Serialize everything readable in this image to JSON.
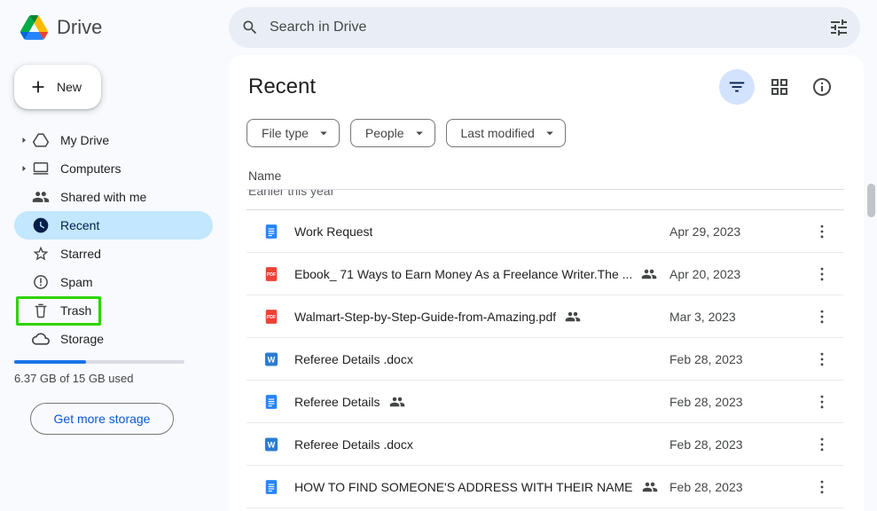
{
  "app": {
    "title": "Drive"
  },
  "topbar": {
    "search_placeholder": "Search in Drive"
  },
  "sidebar": {
    "new_button_label": "New",
    "items": [
      {
        "id": "my-drive",
        "label": "My Drive",
        "icon": "my-drive-icon",
        "expandable": true,
        "selected": false
      },
      {
        "id": "computers",
        "label": "Computers",
        "icon": "computers-icon",
        "expandable": true,
        "selected": false
      },
      {
        "id": "shared-with-me",
        "label": "Shared with me",
        "icon": "shared-icon",
        "expandable": false,
        "selected": false
      },
      {
        "id": "recent",
        "label": "Recent",
        "icon": "recent-icon",
        "expandable": false,
        "selected": true
      },
      {
        "id": "starred",
        "label": "Starred",
        "icon": "starred-icon",
        "expandable": false,
        "selected": false
      },
      {
        "id": "spam",
        "label": "Spam",
        "icon": "spam-icon",
        "expandable": false,
        "selected": false
      },
      {
        "id": "trash",
        "label": "Trash",
        "icon": "trash-icon",
        "expandable": false,
        "selected": false,
        "annotated": true
      },
      {
        "id": "storage",
        "label": "Storage",
        "icon": "storage-icon",
        "expandable": false,
        "selected": false
      }
    ],
    "storage_used_percent": 42,
    "storage_text": "6.37 GB of 15 GB used",
    "get_more_storage_label": "Get more storage"
  },
  "main": {
    "title": "Recent",
    "filter_chips": [
      {
        "label": "File type"
      },
      {
        "label": "People"
      },
      {
        "label": "Last modified"
      }
    ],
    "table": {
      "name_header": "Name",
      "section_label": "Earlier this year",
      "rows": [
        {
          "name": "Work Request",
          "icon": "google-doc-icon",
          "shared": false,
          "date": "Apr 29, 2023"
        },
        {
          "name": "Ebook_ 71 Ways to Earn Money As a Freelance Writer.The ...",
          "icon": "pdf-file-icon",
          "shared": true,
          "date": "Apr 20, 2023"
        },
        {
          "name": "Walmart-Step-by-Step-Guide-from-Amazing.pdf",
          "icon": "pdf-file-icon",
          "shared": true,
          "date": "Mar 3, 2023"
        },
        {
          "name": "Referee Details .docx",
          "icon": "word-file-icon",
          "shared": false,
          "date": "Feb 28, 2023"
        },
        {
          "name": "Referee Details",
          "icon": "google-doc-icon",
          "shared": true,
          "date": "Feb 28, 2023"
        },
        {
          "name": "Referee Details .docx",
          "icon": "word-file-icon",
          "shared": false,
          "date": "Feb 28, 2023"
        },
        {
          "name": "HOW TO FIND SOMEONE'S ADDRESS WITH THEIR NAME",
          "icon": "google-doc-icon",
          "shared": true,
          "date": "Feb 28, 2023"
        }
      ]
    }
  },
  "colors": {
    "accent_blue": "#1a73e8",
    "selected_item_bg": "#c2e7ff",
    "annotation_green": "#2ed300",
    "filter_active_bg": "#d3e3fd",
    "link_blue": "#0b57d0",
    "pdf_red": "#ea4335",
    "word_blue": "#2b7cd3",
    "gdoc_blue": "#2684fc"
  }
}
